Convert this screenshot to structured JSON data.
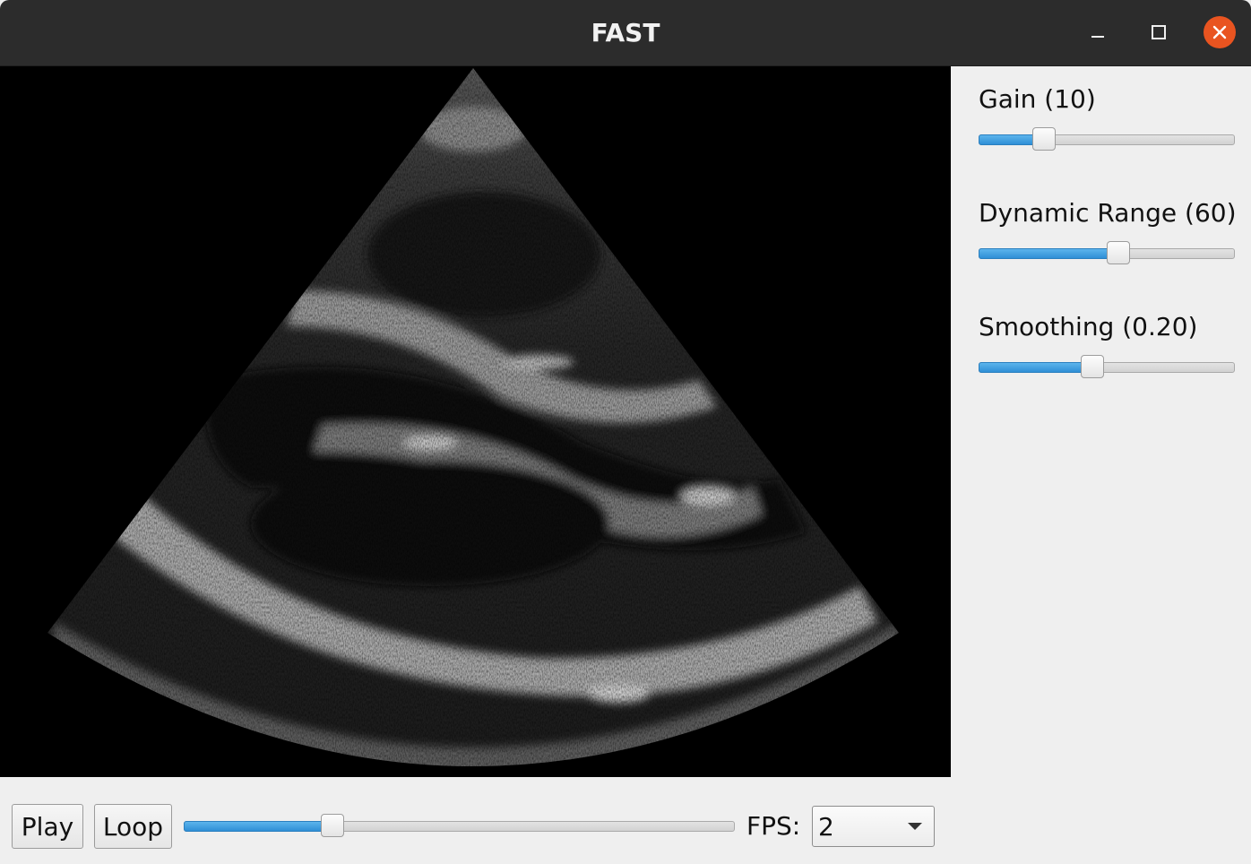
{
  "window": {
    "title": "FAST",
    "buttons": {
      "minimize_icon": "minimize-icon",
      "maximize_icon": "maximize-icon",
      "close_icon": "close-icon"
    },
    "close_color": "#e95420"
  },
  "viewer": {
    "content": "ultrasound-sector-image",
    "background": "#000000"
  },
  "controls": {
    "gain": {
      "label": "Gain (10)",
      "fraction": 0.23
    },
    "dynamic_range": {
      "label": "Dynamic Range (60)",
      "fraction": 0.55
    },
    "smoothing": {
      "label": "Smoothing (0.20)",
      "fraction": 0.44
    }
  },
  "playback": {
    "play_label": "Play",
    "loop_label": "Loop",
    "frame_fraction": 0.26,
    "fps_label": "FPS:",
    "fps_value": "2"
  },
  "colors": {
    "accent": "#3a9be0",
    "titlebar": "#2c2c2c",
    "panel": "#efefef"
  }
}
